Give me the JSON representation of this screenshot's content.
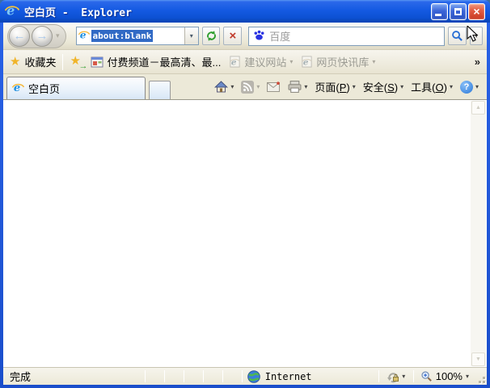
{
  "window": {
    "title": "空白页 -  Explorer"
  },
  "icons": {
    "back_arrow": "←",
    "forward_arrow": "→",
    "chevron_down": "▾",
    "close": "×",
    "stop": "×",
    "star": "★",
    "green_arrow": "→",
    "overflow": "»",
    "scroll_up": "▲",
    "scroll_down": "▼",
    "help": "?"
  },
  "navigation": {
    "address_value": "about:blank",
    "search_placeholder": "百度"
  },
  "favorites_bar": {
    "favorites_label": "收藏夹",
    "pinned_item_label": "付费频道－最高清、最...",
    "suggested_sites_label": "建议网站",
    "web_slices_label": "网页快讯库"
  },
  "tab_bar": {
    "active_tab_label": "空白页"
  },
  "command_bar": {
    "page": {
      "pre": "页面(",
      "key": "P",
      "post": ")"
    },
    "safety": {
      "pre": "安全(",
      "key": "S",
      "post": ")"
    },
    "tools": {
      "pre": "工具(",
      "key": "O",
      "post": ")"
    }
  },
  "status_bar": {
    "status_text": "完成",
    "zone_label": "Internet",
    "zoom_level": "100%"
  },
  "colors": {
    "titlebar_blue": "#1557d6",
    "frame_blue": "#1b53d3",
    "selection_blue": "#316ac5",
    "toolbar_face": "#ece9d8",
    "disabled_text": "#9b9b93",
    "baidu_blue": "#2932e1",
    "close_red": "#d6492f"
  }
}
